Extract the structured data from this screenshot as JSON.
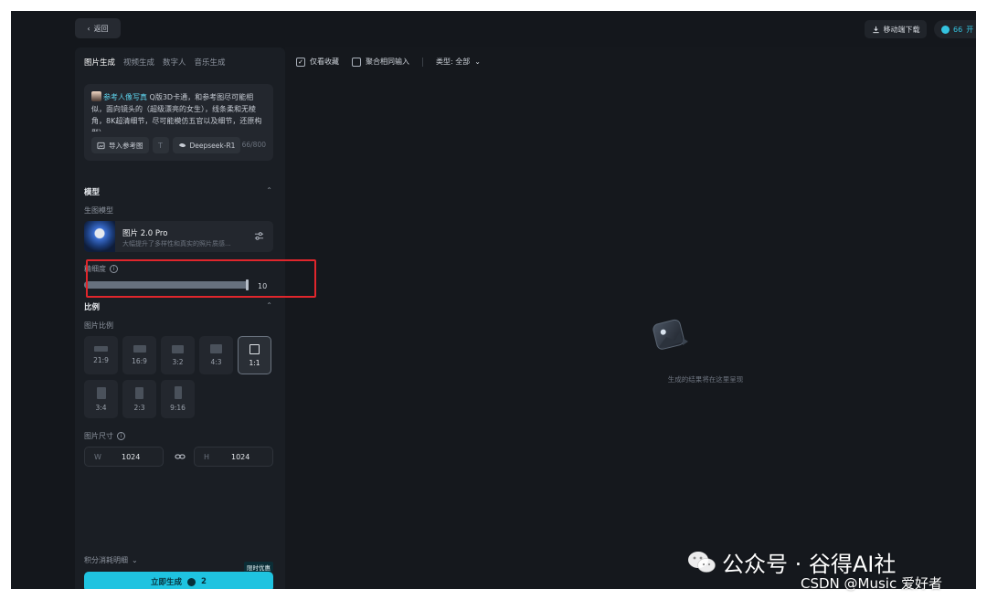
{
  "topbar": {
    "back_label": "返回",
    "download_label": "移动端下载",
    "points_value": "66",
    "points_suffix": "开"
  },
  "tabs": [
    {
      "label": "图片生成",
      "active": true
    },
    {
      "label": "视频生成",
      "active": false
    },
    {
      "label": "数字人",
      "active": false
    },
    {
      "label": "音乐生成",
      "active": false
    }
  ],
  "prompt": {
    "ref_tag": "参考人像写真",
    "text": "Q版3D卡通，和参考图尽可能相似，面向镜头的（超级漂亮的女生），线条柔和无棱角，8K超清细节，尽可能模仿五官以及细节，还原构型）",
    "import_ref_label": "导入参考图",
    "model_chip_label": "Deepseek-R1",
    "char_count": "66/800"
  },
  "model_section": {
    "title": "模型",
    "sub_label": "生图模型",
    "model_name": "图片 2.0 Pro",
    "model_desc": "大幅提升了多样性和真实的照片质感..."
  },
  "precision": {
    "label": "精细度",
    "value": "10",
    "fraction": 1.0
  },
  "ratio_section": {
    "title": "比例",
    "sub_label": "图片比例",
    "options": [
      {
        "label": "21:9",
        "selected": false
      },
      {
        "label": "16:9",
        "selected": false
      },
      {
        "label": "3:2",
        "selected": false
      },
      {
        "label": "4:3",
        "selected": false
      },
      {
        "label": "1:1",
        "selected": true
      },
      {
        "label": "3:4",
        "selected": false
      },
      {
        "label": "2:3",
        "selected": false
      },
      {
        "label": "9:16",
        "selected": false
      }
    ]
  },
  "size_section": {
    "label": "图片尺寸",
    "width_prefix": "W",
    "width_value": "1024",
    "height_prefix": "H",
    "height_value": "1024"
  },
  "footer": {
    "cost_label": "积分消耗明细",
    "generate_label": "立即生成",
    "generate_cost": "2",
    "promo_badge": "限时优惠"
  },
  "filters": {
    "favorites_label": "仅看收藏",
    "merge_label": "聚合相同输入",
    "type_label": "类型: 全部"
  },
  "empty_state": {
    "text": "生成的结果将在这里呈现"
  },
  "watermark": {
    "wechat": "公众号 · 谷得AI社",
    "csdn": "CSDN @Music 爱好者"
  },
  "colors": {
    "accent": "#1fc3e0",
    "highlight_box": "#e0262c",
    "panel_bg": "#1a1e24",
    "app_bg": "#14171c"
  }
}
